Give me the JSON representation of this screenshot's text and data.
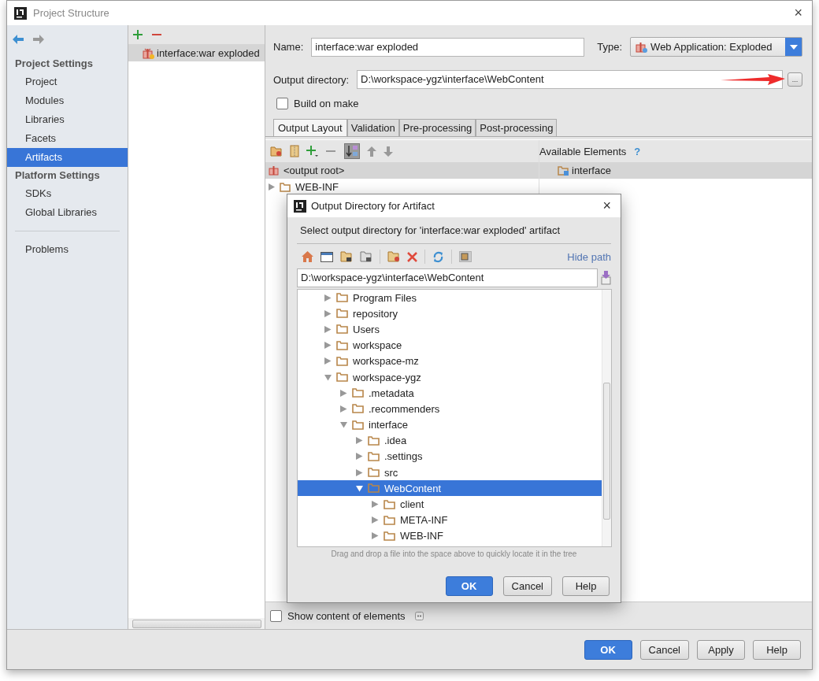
{
  "window": {
    "title": "Project Structure",
    "close": "×"
  },
  "sidebar": {
    "sections": [
      {
        "title": "Project Settings",
        "items": [
          {
            "label": "Project",
            "selected": false
          },
          {
            "label": "Modules",
            "selected": false
          },
          {
            "label": "Libraries",
            "selected": false
          },
          {
            "label": "Facets",
            "selected": false
          },
          {
            "label": "Artifacts",
            "selected": true
          }
        ]
      },
      {
        "title": "Platform Settings",
        "items": [
          {
            "label": "SDKs",
            "selected": false
          },
          {
            "label": "Global Libraries",
            "selected": false
          }
        ]
      }
    ],
    "extra_items": [
      {
        "label": "Problems",
        "selected": false
      }
    ]
  },
  "artifacts": {
    "items": [
      {
        "label": "interface:war exploded",
        "selected": true
      }
    ]
  },
  "form": {
    "name_label": "Name:",
    "name_value": "interface:war exploded",
    "type_label": "Type:",
    "type_value": "Web Application: Exploded",
    "output_label": "Output directory:",
    "output_value": "D:\\workspace-ygz\\interface\\WebContent",
    "browse_button": "...",
    "build_on_make": {
      "label": "Build on make",
      "checked": false
    }
  },
  "tabs": [
    {
      "label": "Output Layout",
      "selected": true
    },
    {
      "label": "Validation",
      "selected": false
    },
    {
      "label": "Pre-processing",
      "selected": false
    },
    {
      "label": "Post-processing",
      "selected": false
    }
  ],
  "layout": {
    "tree": [
      {
        "kind": "root",
        "label": "<output root>",
        "selected": true
      },
      {
        "kind": "folder",
        "label": "WEB-INF",
        "expanded": false,
        "selected": false
      }
    ],
    "available": {
      "title": "Available Elements",
      "help": "?",
      "items": [
        {
          "label": "interface",
          "selected": true
        }
      ]
    },
    "show_content": {
      "label": "Show content of elements",
      "checked": false
    }
  },
  "dialog": {
    "title": "Output Directory for Artifact",
    "close": "×",
    "description": "Select output directory for 'interface:war exploded' artifact",
    "hide_path": "Hide path",
    "path": "D:\\workspace-ygz\\interface\\WebContent",
    "tree": [
      {
        "label": "Program Files",
        "expanded": false,
        "selected": false
      },
      {
        "label": "repository",
        "expanded": false,
        "selected": false
      },
      {
        "label": "Users",
        "expanded": false,
        "selected": false
      },
      {
        "label": "workspace",
        "expanded": false,
        "selected": false
      },
      {
        "label": "workspace-mz",
        "expanded": false,
        "selected": false
      },
      {
        "label": "workspace-ygz",
        "expanded": true,
        "selected": false,
        "children": [
          {
            "label": ".metadata",
            "expanded": false,
            "selected": false
          },
          {
            "label": ".recommenders",
            "expanded": false,
            "selected": false
          },
          {
            "label": "interface",
            "expanded": true,
            "selected": false,
            "children": [
              {
                "label": ".idea",
                "expanded": false,
                "selected": false
              },
              {
                "label": ".settings",
                "expanded": false,
                "selected": false
              },
              {
                "label": "src",
                "expanded": false,
                "selected": false
              },
              {
                "label": "WebContent",
                "expanded": true,
                "selected": true,
                "children": [
                  {
                    "label": "client",
                    "expanded": false,
                    "selected": false
                  },
                  {
                    "label": "META-INF",
                    "expanded": false,
                    "selected": false
                  },
                  {
                    "label": "WEB-INF",
                    "expanded": false,
                    "selected": false
                  }
                ]
              }
            ]
          }
        ]
      }
    ],
    "hint": "Drag and drop a file into the space above to quickly locate it in the tree",
    "buttons": [
      {
        "label": "OK",
        "primary": true
      },
      {
        "label": "Cancel",
        "primary": false
      },
      {
        "label": "Help",
        "primary": false
      }
    ]
  },
  "buttons": [
    {
      "label": "OK",
      "primary": true
    },
    {
      "label": "Cancel",
      "primary": false
    },
    {
      "label": "Apply",
      "primary": false
    },
    {
      "label": "Help",
      "primary": false
    }
  ]
}
